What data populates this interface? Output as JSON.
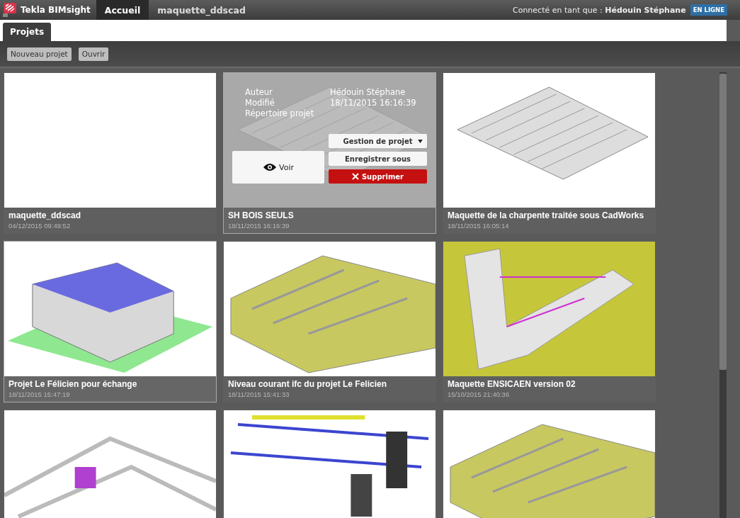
{
  "app": {
    "title": "Tekla BIMsight"
  },
  "top_tabs": [
    {
      "label": "Accueil",
      "selected": true
    },
    {
      "label": "maquette_ddscad",
      "selected": false
    }
  ],
  "user": {
    "prefix": "Connecté en tant que :",
    "name": "Hédouin Stéphane",
    "status": "EN LIGNE"
  },
  "section_tabs": [
    {
      "label": "Projets",
      "selected": true
    }
  ],
  "toolbar": {
    "buttons": [
      "Nouveau projet",
      "Ouvrir"
    ]
  },
  "projects": [
    {
      "kind": "full",
      "title": "maquette_ddscad",
      "date": "04/12/2015 09:49:52",
      "selected": false
    },
    {
      "kind": "full",
      "title": "SH BOIS SEULS",
      "date": "18/11/2015 16:16:39",
      "selected": true,
      "overlay": {
        "rows": [
          {
            "label": "Auteur",
            "value": "Hédouin Stéphane"
          },
          {
            "label": "Modifié",
            "value": "18/11/2015 16:16:39"
          },
          {
            "label": "Répertoire projet"
          }
        ],
        "view": "Voir",
        "menu": "Gestion de projet",
        "save": "Enregistrer sous",
        "delete": "Supprimer"
      }
    },
    {
      "kind": "full",
      "title": "Maquette de la charpente traitée sous CadWorks",
      "date": "18/11/2015 16:05:14",
      "selected": false
    },
    {
      "kind": "full",
      "title": "Projet Le Félicien pour échange",
      "date": "18/11/2015 15:47:19",
      "selected": true
    },
    {
      "kind": "full",
      "title": "Niveau courant  ifc du projet Le Felicien",
      "date": "18/11/2015 15:41:33",
      "selected": false
    },
    {
      "kind": "full",
      "title": "Maquette ENSICAEN version 02",
      "date": "15/10/2015 21:40:36",
      "selected": false
    },
    {
      "kind": "cut"
    },
    {
      "kind": "cut"
    },
    {
      "kind": "cut"
    }
  ]
}
